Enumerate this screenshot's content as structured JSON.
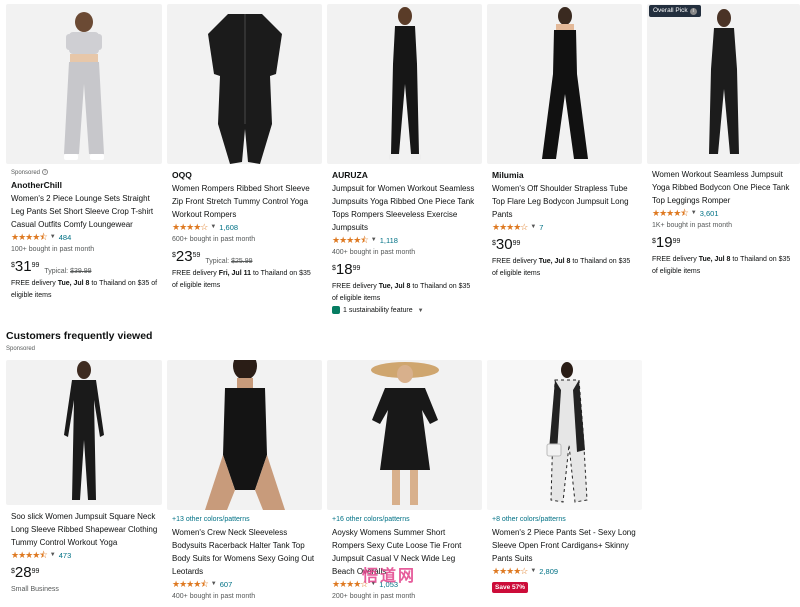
{
  "top_row": [
    {
      "sponsored": "Sponsored",
      "brand": "AnotherChill",
      "title": "Women's 2 Piece Lounge Sets Straight Leg Pants Set Short Sleeve Crop T-shirt Casual Outfits Comfy Loungewear",
      "stars": "★★★★⯪",
      "reviews": "484",
      "bought": "100+ bought in past month",
      "price_whole": "31",
      "price_frac": "99",
      "typical_label": "Typical:",
      "typical_price": "$39.99",
      "delivery_prefix": "FREE delivery",
      "delivery_date": "Tue, Jul 8",
      "delivery_suffix": "to Thailand on $35 of eligible items",
      "image_color": "#d3d3d5"
    },
    {
      "brand": "OQQ",
      "title": "Women Rompers Ribbed Short Sleeve Zip Front Stretch Tummy Control Yoga Workout Rompers",
      "stars": "★★★★☆",
      "reviews": "1,608",
      "bought": "600+ bought in past month",
      "price_whole": "23",
      "price_frac": "59",
      "typical_label": "Typical:",
      "typical_price": "$25.99",
      "delivery_prefix": "FREE delivery",
      "delivery_date": "Fri, Jul 11",
      "delivery_suffix": "to Thailand on $35 of eligible items",
      "image_color": "#1b1b1b"
    },
    {
      "brand": "AURUZA",
      "title": "Jumpsuit for Women Workout Seamless Jumpsuits Yoga Ribbed One Piece Tank Tops Rompers Sleeveless Exercise Jumpsuits",
      "stars": "★★★★⯪",
      "reviews": "1,118",
      "bought": "400+ bought in past month",
      "price_whole": "18",
      "price_frac": "99",
      "delivery_prefix": "FREE delivery",
      "delivery_date": "Tue, Jul 8",
      "delivery_suffix": "to Thailand on $35 of eligible items",
      "sustainability": "1 sustainability feature",
      "image_color": "#161616"
    },
    {
      "brand": "Milumia",
      "title": "Women's Off Shoulder Strapless Tube Top Flare Leg Bodycon Jumpsuit Long Pants",
      "stars": "★★★★☆",
      "reviews": "7",
      "price_whole": "30",
      "price_frac": "99",
      "delivery_prefix": "FREE delivery",
      "delivery_date": "Tue, Jul 8",
      "delivery_suffix": "to Thailand on $35 of eligible items",
      "image_color": "#111111"
    },
    {
      "badge": "Overall Pick",
      "title": "Women Workout Seamless Jumpsuit Yoga Ribbed Bodycon One Piece Tank Top Leggings Romper",
      "stars": "★★★★⯪",
      "reviews": "3,601",
      "bought": "1K+ bought in past month",
      "price_whole": "19",
      "price_frac": "99",
      "delivery_prefix": "FREE delivery",
      "delivery_date": "Tue, Jul 8",
      "delivery_suffix": "to Thailand on $35 of eligible items",
      "image_color": "#1c1c1c"
    }
  ],
  "section": {
    "title": "Customers frequently viewed",
    "sponsored": "Sponsored"
  },
  "bottom_row": [
    {
      "title": "Soo slick Women Jumpsuit Square Neck Long Sleeve Ribbed Shapewear Clothing Tummy Control Workout Yoga",
      "stars": "★★★★⯪",
      "reviews": "473",
      "price_whole": "28",
      "price_frac": "99",
      "extra": "Small Business",
      "image_color": "#1a1a1a"
    },
    {
      "colors_link": "+13 other colors/patterns",
      "title": "Women's Crew Neck Sleeveless Bodysuits Racerback Halter Tank Top Body Suits for Womens Sexy Going Out Leotards",
      "stars": "★★★★⯪",
      "reviews": "607",
      "bought": "400+ bought in past month",
      "image_color": "#141414"
    },
    {
      "colors_link": "+16 other colors/patterns",
      "title": "Aoysky Womens Summer Short Rompers Sexy Cute Loose Tie Front Jumpsuit Casual V Neck Wide Leg Beach Overalls",
      "stars": "★★★★☆",
      "reviews": "1,053",
      "bought": "200+ bought in past month",
      "image_color": "#181818"
    },
    {
      "colors_link": "+8 other colors/patterns",
      "title": "Women's 2 Piece Pants Set - Sexy Long Sleeve Open Front Cardigans+ Skinny Pants Suits",
      "stars": "★★★★☆",
      "reviews": "2,809",
      "save_badge": "Save 57%",
      "image_color": "#e8e8e8"
    }
  ],
  "currency": "$",
  "watermark": "悟道网",
  "colors": {
    "link": "#007185",
    "star": "#de7921",
    "save": "#cc0c39",
    "badge_bg": "#232f3e"
  }
}
